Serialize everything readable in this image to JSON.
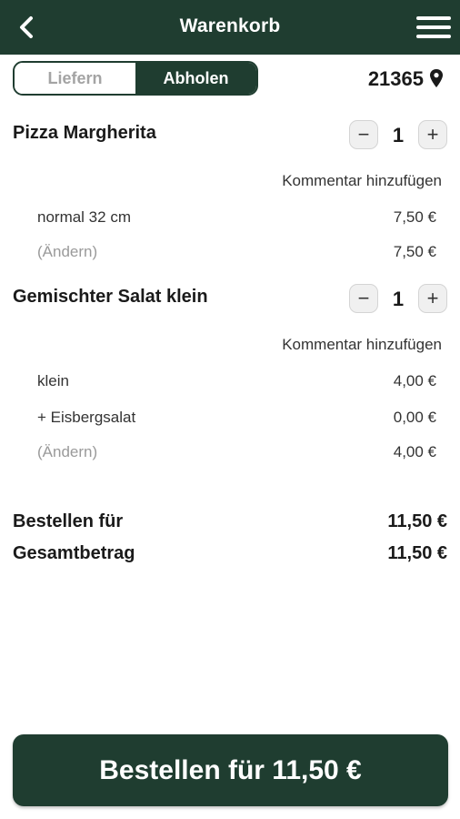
{
  "header": {
    "title": "Warenkorb",
    "back_icon": "chevron-left-icon",
    "menu_icon": "hamburger-menu-icon",
    "background": "#1f3d30"
  },
  "delivery_toggle": {
    "options": [
      "Liefern",
      "Abholen"
    ],
    "selected": "Abholen"
  },
  "location": {
    "zip": "21365",
    "icon": "location-pin-icon"
  },
  "cart": {
    "items": [
      {
        "name": "Pizza Margherita",
        "quantity": "1",
        "comment_label": "Kommentar hinzufügen",
        "options": [
          {
            "label": "normal 32 cm",
            "price": "7,50 €"
          },
          {
            "label": "(Ändern)",
            "price": "7,50 €"
          }
        ]
      },
      {
        "name": "Gemischter Salat klein",
        "quantity": "1",
        "comment_label": "Kommentar hinzufügen",
        "options": [
          {
            "label": "klein",
            "price": "4,00 €"
          },
          {
            "label": "+ Eisbergsalat",
            "price": "0,00 €"
          },
          {
            "label": "(Ändern)",
            "price": "4,00 €"
          }
        ]
      }
    ]
  },
  "stepper": {
    "minus": "−",
    "plus": "+"
  },
  "totals": [
    {
      "label": "Bestellen für",
      "value": "11,50 €"
    },
    {
      "label": "Gesamtbetrag",
      "value": "11,50 €"
    }
  ],
  "order_button": {
    "label": "Bestellen für 11,50 €"
  },
  "colors": {
    "accent": "#1f3d30",
    "muted": "#9a9a9a"
  }
}
